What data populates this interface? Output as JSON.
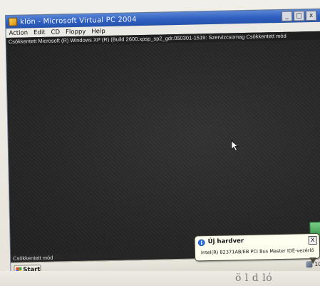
{
  "window": {
    "title": "klón - Microsoft Virtual PC 2004",
    "buttons": {
      "minimize": "_",
      "maximize": "□",
      "close": "x"
    }
  },
  "menubar": {
    "items": [
      "Action",
      "Edit",
      "CD",
      "Floppy",
      "Help"
    ]
  },
  "vm": {
    "header_text": "Csökkentett Microsoft (R) Windows XP (R) (Build 2600.xpsp_sp2_gdr.050301-1519: Szervizcsomag Csökkentett mód",
    "footer_text": "Csökkentett mód"
  },
  "taskbar": {
    "start_label": "Start",
    "tray_time": "10"
  },
  "notification": {
    "title": "Új hardver",
    "text": "Intel(R) 82371AB/EB PCI Bus Master IDE-vezérlő",
    "close_label": "X"
  },
  "page": {
    "caption": "ö l d ló"
  },
  "colors": {
    "titlebar": "#2f5fbf",
    "vm_background": "#2a2a2a",
    "balloon": "#fffff0"
  }
}
